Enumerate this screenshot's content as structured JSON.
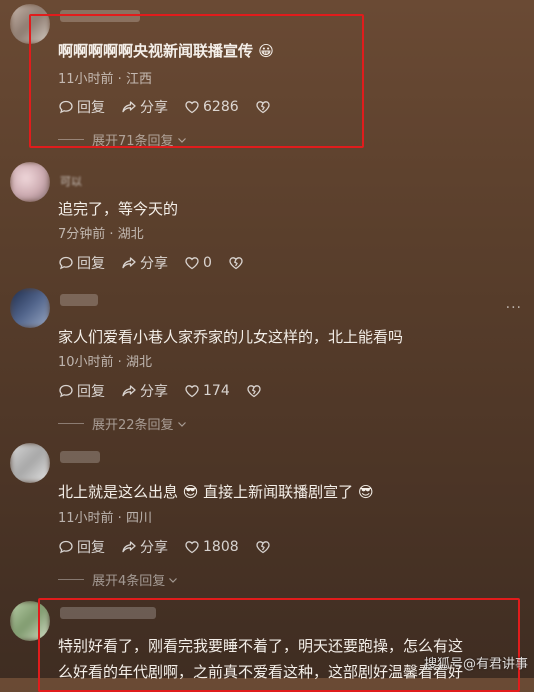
{
  "comments": [
    {
      "text": "啊啊啊啊啊央视新闻联播宣传 😀",
      "meta": "11小时前 · 江西",
      "reply_label": "回复",
      "share_label": "分享",
      "likes": "6286",
      "expand": "展开71条回复"
    },
    {
      "username": "可以",
      "text": "追完了，等今天的",
      "meta": "7分钟前 · 湖北",
      "reply_label": "回复",
      "share_label": "分享",
      "likes": "0"
    },
    {
      "text": "家人们爱看小巷人家乔家的儿女这样的，北上能看吗",
      "meta": "10小时前 · 湖北",
      "reply_label": "回复",
      "share_label": "分享",
      "likes": "174",
      "expand": "展开22条回复"
    },
    {
      "text": "北上就是这么出息 😎 直接上新闻联播剧宣了 😎",
      "meta": "11小时前 · 四川",
      "reply_label": "回复",
      "share_label": "分享",
      "likes": "1808",
      "expand": "展开4条回复"
    },
    {
      "text_line1": "特别好看了，刚看完我要睡不着了，明天还要跑操，怎么有这",
      "text_line2": "么好看的年代剧啊，之前真不爱看这种，这部剧好温馨看看好"
    }
  ],
  "more_label": "···",
  "watermark": "搜狐号@有君讲事",
  "colors": {
    "highlight_box": "#e11c1c",
    "background": "#5a3f2c"
  }
}
